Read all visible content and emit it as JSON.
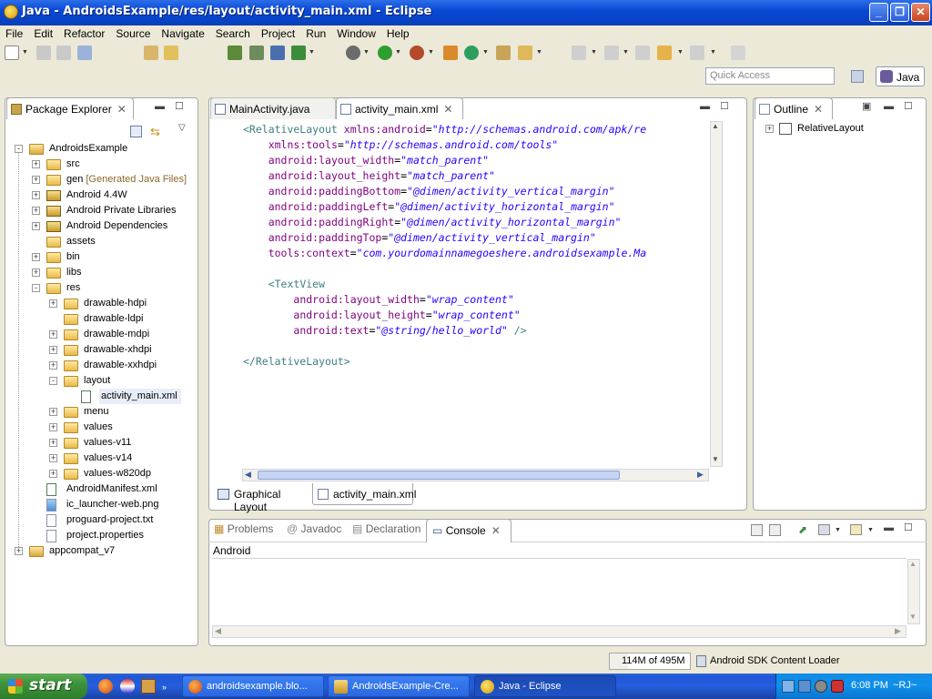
{
  "window": {
    "title": "Java - AndroidsExample/res/layout/activity_main.xml - Eclipse",
    "minimize": "_",
    "restore": "❐",
    "close": "✕"
  },
  "menu": [
    "File",
    "Edit",
    "Refactor",
    "Source",
    "Navigate",
    "Search",
    "Project",
    "Run",
    "Window",
    "Help"
  ],
  "quick_access": {
    "placeholder": "Quick Access"
  },
  "perspective": {
    "label": "Java"
  },
  "package_explorer": {
    "title": "Package Explorer",
    "tree": [
      {
        "label": "AndroidsExample",
        "depth": 0,
        "exp": "-",
        "icon": "project-icon"
      },
      {
        "label": "src",
        "depth": 1,
        "exp": "+",
        "icon": "folder-icon"
      },
      {
        "label": "gen",
        "extra": "[Generated Java Files]",
        "depth": 1,
        "exp": "+",
        "icon": "folder-icon"
      },
      {
        "label": "Android 4.4W",
        "depth": 1,
        "exp": "+",
        "icon": "library-icon"
      },
      {
        "label": "Android Private Libraries",
        "depth": 1,
        "exp": "+",
        "icon": "library-icon"
      },
      {
        "label": "Android Dependencies",
        "depth": 1,
        "exp": "+",
        "icon": "library-icon"
      },
      {
        "label": "assets",
        "depth": 1,
        "exp": "",
        "icon": "folder-icon"
      },
      {
        "label": "bin",
        "depth": 1,
        "exp": "+",
        "icon": "folder-icon"
      },
      {
        "label": "libs",
        "depth": 1,
        "exp": "+",
        "icon": "folder-icon"
      },
      {
        "label": "res",
        "depth": 1,
        "exp": "-",
        "icon": "folder-icon"
      },
      {
        "label": "drawable-hdpi",
        "depth": 2,
        "exp": "+",
        "icon": "folder-icon"
      },
      {
        "label": "drawable-ldpi",
        "depth": 2,
        "exp": "",
        "icon": "folder-icon"
      },
      {
        "label": "drawable-mdpi",
        "depth": 2,
        "exp": "+",
        "icon": "folder-icon"
      },
      {
        "label": "drawable-xhdpi",
        "depth": 2,
        "exp": "+",
        "icon": "folder-icon"
      },
      {
        "label": "drawable-xxhdpi",
        "depth": 2,
        "exp": "+",
        "icon": "folder-icon"
      },
      {
        "label": "layout",
        "depth": 2,
        "exp": "-",
        "icon": "folder-icon"
      },
      {
        "label": "activity_main.xml",
        "depth": 3,
        "exp": "",
        "icon": "xml-file-icon",
        "selected": true
      },
      {
        "label": "menu",
        "depth": 2,
        "exp": "+",
        "icon": "folder-icon"
      },
      {
        "label": "values",
        "depth": 2,
        "exp": "+",
        "icon": "folder-icon"
      },
      {
        "label": "values-v11",
        "depth": 2,
        "exp": "+",
        "icon": "folder-icon"
      },
      {
        "label": "values-v14",
        "depth": 2,
        "exp": "+",
        "icon": "folder-icon"
      },
      {
        "label": "values-w820dp",
        "depth": 2,
        "exp": "+",
        "icon": "folder-icon"
      },
      {
        "label": "AndroidManifest.xml",
        "depth": 1,
        "exp": "",
        "icon": "xml-file-icon"
      },
      {
        "label": "ic_launcher-web.png",
        "depth": 1,
        "exp": "",
        "icon": "image-file-icon"
      },
      {
        "label": "proguard-project.txt",
        "depth": 1,
        "exp": "",
        "icon": "text-file-icon"
      },
      {
        "label": "project.properties",
        "depth": 1,
        "exp": "",
        "icon": "text-file-icon"
      },
      {
        "label": "appcompat_v7",
        "depth": 0,
        "exp": "+",
        "icon": "project-icon"
      }
    ]
  },
  "editor": {
    "tabs": [
      {
        "label": "MainActivity.java",
        "active": false
      },
      {
        "label": "activity_main.xml",
        "active": true
      }
    ],
    "lines": [
      [
        {
          "t": "tg",
          "s": "<RelativeLayout "
        },
        {
          "t": "at",
          "s": "xmlns:android"
        },
        {
          "t": "eq",
          "s": "="
        },
        {
          "t": "vl",
          "s": "\"http://schemas.android.com/apk/re"
        }
      ],
      [
        {
          "t": "eq",
          "s": "    "
        },
        {
          "t": "at",
          "s": "xmlns:tools"
        },
        {
          "t": "eq",
          "s": "="
        },
        {
          "t": "vl",
          "s": "\"http://schemas.android.com/tools\""
        }
      ],
      [
        {
          "t": "eq",
          "s": "    "
        },
        {
          "t": "at",
          "s": "android:layout_width"
        },
        {
          "t": "eq",
          "s": "="
        },
        {
          "t": "vl",
          "s": "\"match_parent\""
        }
      ],
      [
        {
          "t": "eq",
          "s": "    "
        },
        {
          "t": "at",
          "s": "android:layout_height"
        },
        {
          "t": "eq",
          "s": "="
        },
        {
          "t": "vl",
          "s": "\"match_parent\""
        }
      ],
      [
        {
          "t": "eq",
          "s": "    "
        },
        {
          "t": "at",
          "s": "android:paddingBottom"
        },
        {
          "t": "eq",
          "s": "="
        },
        {
          "t": "vl",
          "s": "\"@dimen/activity_vertical_margin\""
        }
      ],
      [
        {
          "t": "eq",
          "s": "    "
        },
        {
          "t": "at",
          "s": "android:paddingLeft"
        },
        {
          "t": "eq",
          "s": "="
        },
        {
          "t": "vl",
          "s": "\"@dimen/activity_horizontal_margin\""
        }
      ],
      [
        {
          "t": "eq",
          "s": "    "
        },
        {
          "t": "at",
          "s": "android:paddingRight"
        },
        {
          "t": "eq",
          "s": "="
        },
        {
          "t": "vl",
          "s": "\"@dimen/activity_horizontal_margin\""
        }
      ],
      [
        {
          "t": "eq",
          "s": "    "
        },
        {
          "t": "at",
          "s": "android:paddingTop"
        },
        {
          "t": "eq",
          "s": "="
        },
        {
          "t": "vl",
          "s": "\"@dimen/activity_vertical_margin\""
        }
      ],
      [
        {
          "t": "eq",
          "s": "    "
        },
        {
          "t": "at",
          "s": "tools:context"
        },
        {
          "t": "eq",
          "s": "="
        },
        {
          "t": "vl",
          "s": "\"com.yourdomainnamegoeshere.androidsexample.Ma"
        }
      ],
      [],
      [
        {
          "t": "eq",
          "s": "    "
        },
        {
          "t": "tg",
          "s": "<TextView"
        }
      ],
      [
        {
          "t": "eq",
          "s": "        "
        },
        {
          "t": "at",
          "s": "android:layout_width"
        },
        {
          "t": "eq",
          "s": "="
        },
        {
          "t": "vl",
          "s": "\"wrap_content\""
        }
      ],
      [
        {
          "t": "eq",
          "s": "        "
        },
        {
          "t": "at",
          "s": "android:layout_height"
        },
        {
          "t": "eq",
          "s": "="
        },
        {
          "t": "vl",
          "s": "\"wrap_content\""
        }
      ],
      [
        {
          "t": "eq",
          "s": "        "
        },
        {
          "t": "at",
          "s": "android:text"
        },
        {
          "t": "eq",
          "s": "="
        },
        {
          "t": "vl",
          "s": "\"@string/hello_world\""
        },
        {
          "t": "tg",
          "s": " />"
        }
      ],
      [],
      [
        {
          "t": "tg",
          "s": "</RelativeLayout>"
        }
      ]
    ],
    "bottom_tabs": [
      {
        "label": "Graphical Layout",
        "active": false
      },
      {
        "label": "activity_main.xml",
        "active": true
      }
    ]
  },
  "outline": {
    "title": "Outline",
    "root": "RelativeLayout"
  },
  "console_panel": {
    "tabs": [
      {
        "label": "Problems",
        "active": false
      },
      {
        "label": "Javadoc",
        "active": false
      },
      {
        "label": "Declaration",
        "active": false
      },
      {
        "label": "Console",
        "active": true
      }
    ],
    "header": "Android"
  },
  "status": {
    "heap": "114M of 495M",
    "task": "Android SDK Content Loader"
  },
  "taskbar": {
    "start": "start",
    "tasks": [
      {
        "label": "androidsexample.blo...",
        "active": false
      },
      {
        "label": "AndroidsExample-Cre...",
        "active": false
      },
      {
        "label": "Java - Eclipse",
        "active": true
      }
    ],
    "clock": "6:08 PM",
    "user": "~RJ~"
  },
  "colors": {
    "xml_tag": "#3f7f7f",
    "xml_attr": "#7f007f",
    "xml_value": "#2a00ff",
    "selection": "#e8eef9",
    "titlebar": "#0a49d6",
    "taskbar": "#245edc",
    "start_button": "#3c923a"
  }
}
